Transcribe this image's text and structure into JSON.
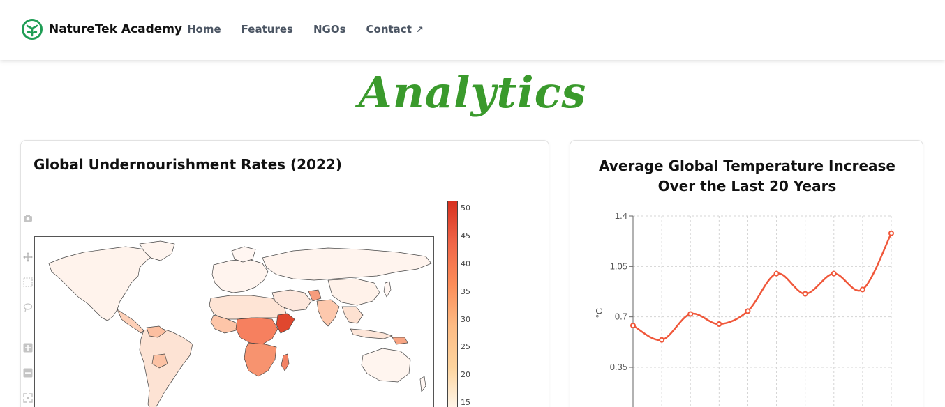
{
  "navbar": {
    "brand": "NatureTek Academy",
    "links": [
      {
        "label": "Home"
      },
      {
        "label": "Features"
      },
      {
        "label": "NGOs"
      },
      {
        "label": "Contact",
        "icon": "external-arrow-icon"
      }
    ]
  },
  "page": {
    "title": "Analytics",
    "title_color": "#3a9a2c"
  },
  "map_card": {
    "title": "Global Undernourishment Rates (2022)",
    "modebar": [
      "camera-icon",
      "pan-icon",
      "box-select-icon",
      "lasso-icon",
      "zoom-in-icon",
      "zoom-out-icon",
      "reset-icon"
    ],
    "colorbar_ticks": [
      "50",
      "45",
      "40",
      "35",
      "30",
      "25",
      "20",
      "15"
    ]
  },
  "chart_data": {
    "type": "line",
    "title": "Average Global Temperature Increase Over the Last 20 Years",
    "ylabel": "°C",
    "xlabel": "",
    "ylim": [
      0,
      1.4
    ],
    "yticks": [
      "1.4",
      "1.05",
      "0.7",
      "0.35"
    ],
    "series": [
      {
        "color": "#f0573a",
        "values": [
          0.64,
          0.54,
          0.72,
          0.65,
          0.74,
          1.0,
          0.86,
          1.0,
          0.89,
          1.28
        ]
      }
    ],
    "grid": true
  }
}
